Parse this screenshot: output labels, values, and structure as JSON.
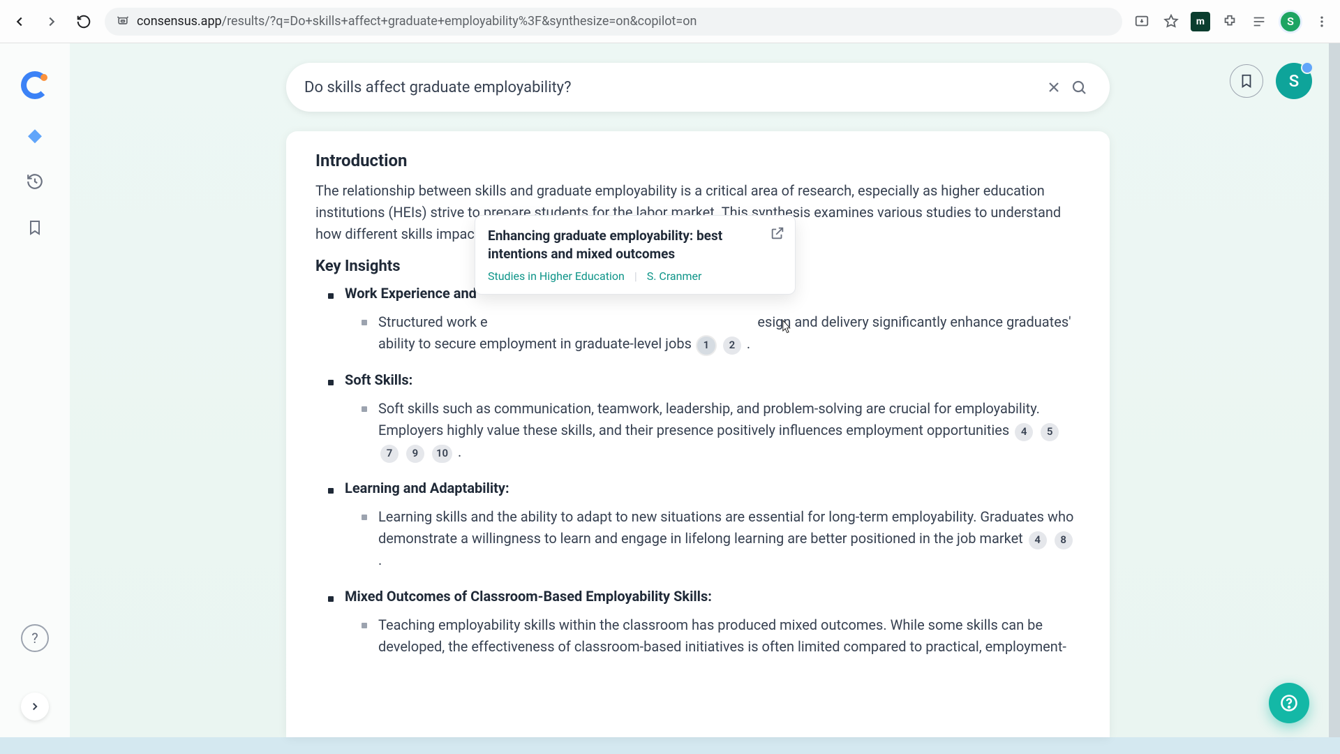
{
  "chrome": {
    "url_domain": "consensus.app",
    "url_rest": "/results/?q=Do+skills+affect+graduate+employability%3F&synthesize=on&copilot=on",
    "ext_badge": "m",
    "profile_initial": "S"
  },
  "sidebar": {
    "help_label": "?"
  },
  "header": {
    "avatar_initial": "S"
  },
  "search": {
    "query": "Do skills affect graduate employability?"
  },
  "content": {
    "intro_heading": "Introduction",
    "intro_text": "The relationship between skills and graduate employability is a critical area of research, especially as higher education institutions (HEIs) strive to prepare students for the labor market. This synthesis examines various studies to understand how different skills impact the employability of graduates.",
    "insights_heading": "Key Insights",
    "insights": [
      {
        "title": "Work Experience and",
        "body_pre": "Structured work e",
        "body_mid": "esign and delivery significantly enhance graduates' ability to secure employment in graduate-level jobs",
        "citations": [
          "1",
          "2"
        ],
        "trailing": "."
      },
      {
        "title": "Soft Skills:",
        "body": "Soft skills such as communication, teamwork, leadership, and problem-solving are crucial for employability. Employers highly value these skills, and their presence positively influences employment opportunities",
        "citations": [
          "4",
          "5",
          "7",
          "9",
          "10"
        ],
        "trailing": "."
      },
      {
        "title": "Learning and Adaptability:",
        "body": "Learning skills and the ability to adapt to new situations are essential for long-term employability. Graduates who demonstrate a willingness to learn and engage in lifelong learning are better positioned in the job market",
        "citations": [
          "4",
          "8"
        ],
        "trailing": "."
      },
      {
        "title": "Mixed Outcomes of Classroom-Based Employability Skills:",
        "body": "Teaching employability skills within the classroom has produced mixed outcomes. While some skills can be developed, the effectiveness of classroom-based initiatives is often limited compared to practical, employment-",
        "citations": [],
        "trailing": ""
      }
    ]
  },
  "popover": {
    "title": "Enhancing graduate employability: best intentions and mixed outcomes",
    "journal": "Studies in Higher Education",
    "author": "S. Cranmer"
  }
}
